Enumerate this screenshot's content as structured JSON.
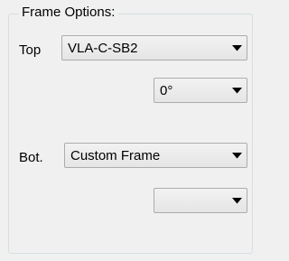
{
  "group": {
    "title": "Frame Options:"
  },
  "top": {
    "label": "Top",
    "frame_value": "VLA-C-SB2",
    "angle_value": "0°"
  },
  "bottom": {
    "label": "Bot.",
    "frame_value": "Custom Frame",
    "angle_value": ""
  },
  "icons": {
    "dropdown": "chevron-down-icon"
  }
}
